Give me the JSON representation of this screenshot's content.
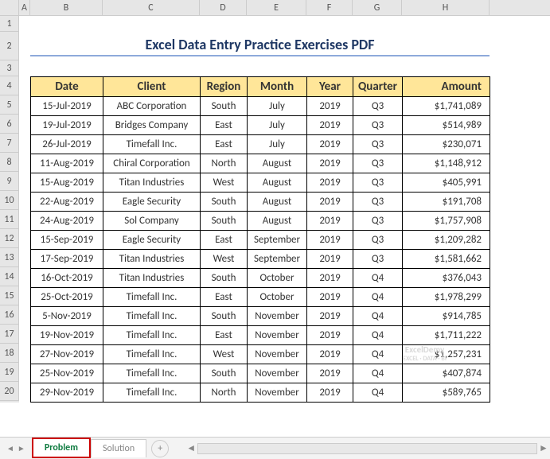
{
  "columns": [
    "A",
    "B",
    "C",
    "D",
    "E",
    "F",
    "G",
    "H"
  ],
  "title": "Excel Data Entry Practice Exercises PDF",
  "headers": {
    "date": "Date",
    "client": "Client",
    "region": "Region",
    "month": "Month",
    "year": "Year",
    "quarter": "Quarter",
    "amount": "Amount"
  },
  "rows": [
    {
      "date": "15-Jul-2019",
      "client": "ABC Corporation",
      "region": "South",
      "month": "July",
      "year": "2019",
      "quarter": "Q3",
      "amount": "$1,741,089"
    },
    {
      "date": "19-Jul-2019",
      "client": "Bridges Company",
      "region": "East",
      "month": "July",
      "year": "2019",
      "quarter": "Q3",
      "amount": "$514,989"
    },
    {
      "date": "26-Jul-2019",
      "client": "Timefall Inc.",
      "region": "East",
      "month": "July",
      "year": "2019",
      "quarter": "Q3",
      "amount": "$230,071"
    },
    {
      "date": "11-Aug-2019",
      "client": "Chiral Corporation",
      "region": "North",
      "month": "August",
      "year": "2019",
      "quarter": "Q3",
      "amount": "$1,148,912"
    },
    {
      "date": "15-Aug-2019",
      "client": "Titan Industries",
      "region": "West",
      "month": "August",
      "year": "2019",
      "quarter": "Q3",
      "amount": "$405,991"
    },
    {
      "date": "22-Aug-2019",
      "client": "Eagle Security",
      "region": "South",
      "month": "August",
      "year": "2019",
      "quarter": "Q3",
      "amount": "$191,708"
    },
    {
      "date": "24-Aug-2019",
      "client": "Sol Company",
      "region": "South",
      "month": "August",
      "year": "2019",
      "quarter": "Q3",
      "amount": "$1,757,908"
    },
    {
      "date": "15-Sep-2019",
      "client": "Eagle Security",
      "region": "East",
      "month": "September",
      "year": "2019",
      "quarter": "Q3",
      "amount": "$1,209,282"
    },
    {
      "date": "17-Sep-2019",
      "client": "Titan Industries",
      "region": "West",
      "month": "September",
      "year": "2019",
      "quarter": "Q3",
      "amount": "$1,581,662"
    },
    {
      "date": "16-Oct-2019",
      "client": "Titan Industries",
      "region": "South",
      "month": "October",
      "year": "2019",
      "quarter": "Q4",
      "amount": "$376,043"
    },
    {
      "date": "25-Oct-2019",
      "client": "Timefall Inc.",
      "region": "East",
      "month": "October",
      "year": "2019",
      "quarter": "Q4",
      "amount": "$1,978,299"
    },
    {
      "date": "5-Nov-2019",
      "client": "Timefall Inc.",
      "region": "South",
      "month": "November",
      "year": "2019",
      "quarter": "Q4",
      "amount": "$914,785"
    },
    {
      "date": "19-Nov-2019",
      "client": "Timefall Inc.",
      "region": "East",
      "month": "November",
      "year": "2019",
      "quarter": "Q4",
      "amount": "$1,711,222"
    },
    {
      "date": "27-Nov-2019",
      "client": "Timefall Inc.",
      "region": "West",
      "month": "November",
      "year": "2019",
      "quarter": "Q4",
      "amount": "$1,257,231"
    },
    {
      "date": "25-Nov-2019",
      "client": "Timefall Inc.",
      "region": "South",
      "month": "November",
      "year": "2019",
      "quarter": "Q4",
      "amount": "$407,874"
    },
    {
      "date": "29-Nov-2019",
      "client": "Timefall Inc.",
      "region": "North",
      "month": "November",
      "year": "2019",
      "quarter": "Q4",
      "amount": "$589,765"
    }
  ],
  "tabs": {
    "active": "Problem",
    "inactive": "Solution",
    "add": "+"
  },
  "watermark": {
    "line1": "ExcelDemy",
    "line2": "EXCEL · DATA · BI"
  },
  "rownums": [
    "1",
    "2",
    "3",
    "4",
    "5",
    "6",
    "7",
    "8",
    "9",
    "10",
    "11",
    "12",
    "13",
    "14",
    "15",
    "16",
    "17",
    "18",
    "19",
    "20"
  ]
}
